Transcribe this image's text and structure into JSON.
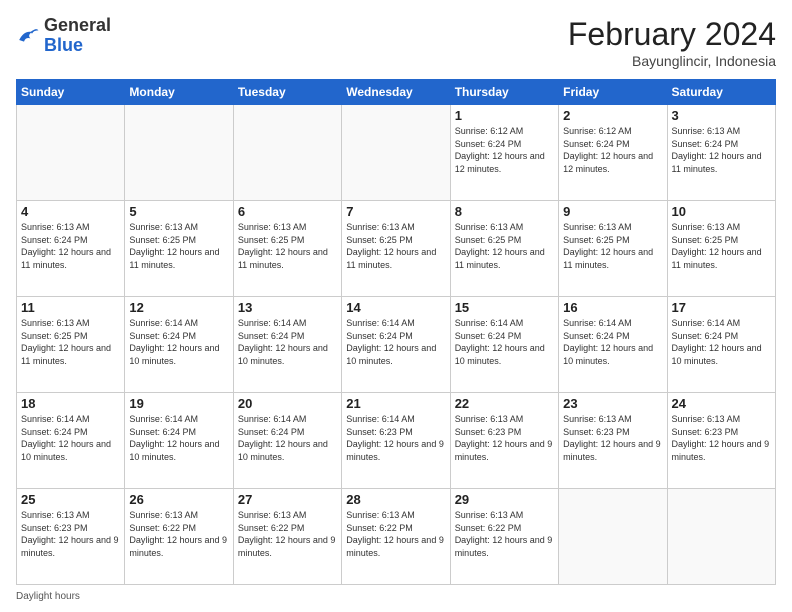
{
  "header": {
    "logo_general": "General",
    "logo_blue": "Blue",
    "month_year": "February 2024",
    "location": "Bayunglincir, Indonesia"
  },
  "days_of_week": [
    "Sunday",
    "Monday",
    "Tuesday",
    "Wednesday",
    "Thursday",
    "Friday",
    "Saturday"
  ],
  "weeks": [
    [
      {
        "num": "",
        "info": ""
      },
      {
        "num": "",
        "info": ""
      },
      {
        "num": "",
        "info": ""
      },
      {
        "num": "",
        "info": ""
      },
      {
        "num": "1",
        "info": "Sunrise: 6:12 AM\nSunset: 6:24 PM\nDaylight: 12 hours\nand 12 minutes."
      },
      {
        "num": "2",
        "info": "Sunrise: 6:12 AM\nSunset: 6:24 PM\nDaylight: 12 hours\nand 12 minutes."
      },
      {
        "num": "3",
        "info": "Sunrise: 6:13 AM\nSunset: 6:24 PM\nDaylight: 12 hours\nand 11 minutes."
      }
    ],
    [
      {
        "num": "4",
        "info": "Sunrise: 6:13 AM\nSunset: 6:24 PM\nDaylight: 12 hours\nand 11 minutes."
      },
      {
        "num": "5",
        "info": "Sunrise: 6:13 AM\nSunset: 6:25 PM\nDaylight: 12 hours\nand 11 minutes."
      },
      {
        "num": "6",
        "info": "Sunrise: 6:13 AM\nSunset: 6:25 PM\nDaylight: 12 hours\nand 11 minutes."
      },
      {
        "num": "7",
        "info": "Sunrise: 6:13 AM\nSunset: 6:25 PM\nDaylight: 12 hours\nand 11 minutes."
      },
      {
        "num": "8",
        "info": "Sunrise: 6:13 AM\nSunset: 6:25 PM\nDaylight: 12 hours\nand 11 minutes."
      },
      {
        "num": "9",
        "info": "Sunrise: 6:13 AM\nSunset: 6:25 PM\nDaylight: 12 hours\nand 11 minutes."
      },
      {
        "num": "10",
        "info": "Sunrise: 6:13 AM\nSunset: 6:25 PM\nDaylight: 12 hours\nand 11 minutes."
      }
    ],
    [
      {
        "num": "11",
        "info": "Sunrise: 6:13 AM\nSunset: 6:25 PM\nDaylight: 12 hours\nand 11 minutes."
      },
      {
        "num": "12",
        "info": "Sunrise: 6:14 AM\nSunset: 6:24 PM\nDaylight: 12 hours\nand 10 minutes."
      },
      {
        "num": "13",
        "info": "Sunrise: 6:14 AM\nSunset: 6:24 PM\nDaylight: 12 hours\nand 10 minutes."
      },
      {
        "num": "14",
        "info": "Sunrise: 6:14 AM\nSunset: 6:24 PM\nDaylight: 12 hours\nand 10 minutes."
      },
      {
        "num": "15",
        "info": "Sunrise: 6:14 AM\nSunset: 6:24 PM\nDaylight: 12 hours\nand 10 minutes."
      },
      {
        "num": "16",
        "info": "Sunrise: 6:14 AM\nSunset: 6:24 PM\nDaylight: 12 hours\nand 10 minutes."
      },
      {
        "num": "17",
        "info": "Sunrise: 6:14 AM\nSunset: 6:24 PM\nDaylight: 12 hours\nand 10 minutes."
      }
    ],
    [
      {
        "num": "18",
        "info": "Sunrise: 6:14 AM\nSunset: 6:24 PM\nDaylight: 12 hours\nand 10 minutes."
      },
      {
        "num": "19",
        "info": "Sunrise: 6:14 AM\nSunset: 6:24 PM\nDaylight: 12 hours\nand 10 minutes."
      },
      {
        "num": "20",
        "info": "Sunrise: 6:14 AM\nSunset: 6:24 PM\nDaylight: 12 hours\nand 10 minutes."
      },
      {
        "num": "21",
        "info": "Sunrise: 6:14 AM\nSunset: 6:23 PM\nDaylight: 12 hours\nand 9 minutes."
      },
      {
        "num": "22",
        "info": "Sunrise: 6:13 AM\nSunset: 6:23 PM\nDaylight: 12 hours\nand 9 minutes."
      },
      {
        "num": "23",
        "info": "Sunrise: 6:13 AM\nSunset: 6:23 PM\nDaylight: 12 hours\nand 9 minutes."
      },
      {
        "num": "24",
        "info": "Sunrise: 6:13 AM\nSunset: 6:23 PM\nDaylight: 12 hours\nand 9 minutes."
      }
    ],
    [
      {
        "num": "25",
        "info": "Sunrise: 6:13 AM\nSunset: 6:23 PM\nDaylight: 12 hours\nand 9 minutes."
      },
      {
        "num": "26",
        "info": "Sunrise: 6:13 AM\nSunset: 6:22 PM\nDaylight: 12 hours\nand 9 minutes."
      },
      {
        "num": "27",
        "info": "Sunrise: 6:13 AM\nSunset: 6:22 PM\nDaylight: 12 hours\nand 9 minutes."
      },
      {
        "num": "28",
        "info": "Sunrise: 6:13 AM\nSunset: 6:22 PM\nDaylight: 12 hours\nand 9 minutes."
      },
      {
        "num": "29",
        "info": "Sunrise: 6:13 AM\nSunset: 6:22 PM\nDaylight: 12 hours\nand 9 minutes."
      },
      {
        "num": "",
        "info": ""
      },
      {
        "num": "",
        "info": ""
      }
    ]
  ],
  "footer": {
    "daylight_label": "Daylight hours"
  }
}
